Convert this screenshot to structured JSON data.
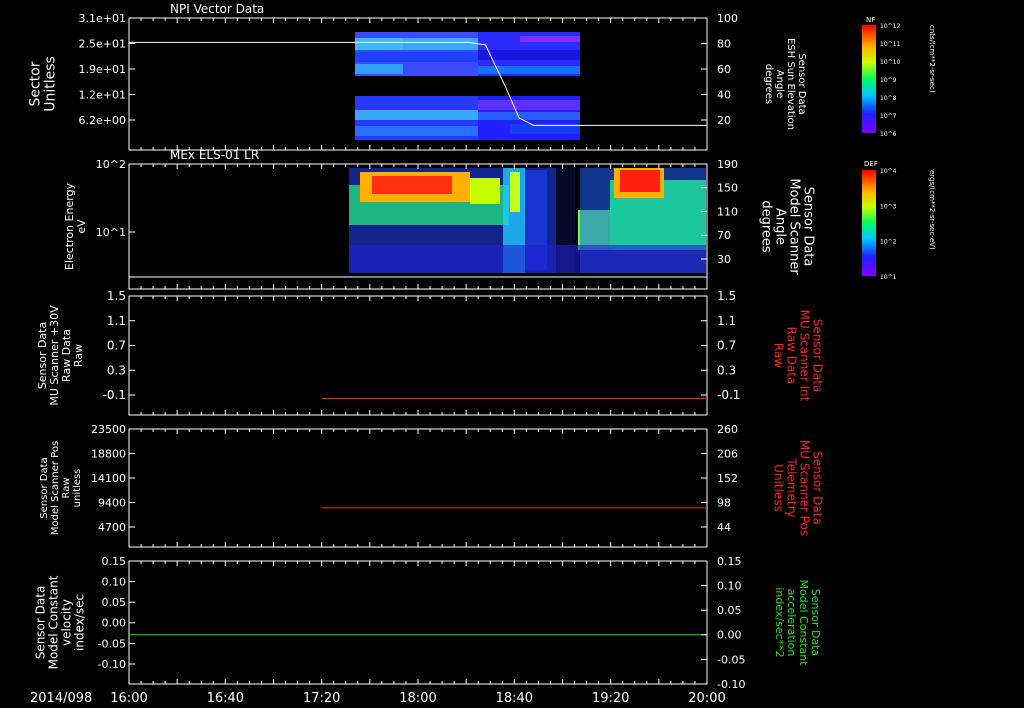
{
  "time_axis": {
    "date_label": "2014/098",
    "tick_labels": [
      "16:00",
      "16:40",
      "17:20",
      "18:00",
      "18:40",
      "19:20",
      "20:00"
    ],
    "range": [
      "16:00",
      "20:00"
    ]
  },
  "colors": {
    "white": "#ffffff",
    "red": "#ff2020",
    "green": "#20e020"
  },
  "chart_data": [
    {
      "type": "heatmap",
      "panel_id": "npi",
      "title": "NPI Vector Data",
      "ylabel": [
        "Sector",
        "Unitless"
      ],
      "yticks": [
        "3.1e+01",
        "2.5e+01",
        "1.9e+01",
        "1.2e+01",
        "6.2e+00"
      ],
      "y2label": [
        "Sensor Data",
        "ESH Sun Elevation",
        "Angle",
        "degrees"
      ],
      "y2ticks": [
        "100",
        "80",
        "60",
        "40",
        "20"
      ],
      "colorbar": {
        "tag": "NF",
        "label": "cnts/(cm**2-sr-sec)",
        "ticks": [
          "10^12",
          "10^11",
          "10^10",
          "10^9",
          "10^8",
          "10^7",
          "10^6"
        ]
      },
      "data_window": [
        "17:24",
        "19:00"
      ],
      "overlay_line": {
        "color": "#ffffff",
        "units": "degrees",
        "points": [
          [
            "16:00",
            80
          ],
          [
            "18:21",
            80
          ],
          [
            "18:28",
            78
          ],
          [
            "18:36",
            45
          ],
          [
            "18:42",
            18
          ],
          [
            "18:48",
            12
          ],
          [
            "20:00",
            12
          ]
        ]
      }
    },
    {
      "type": "heatmap",
      "panel_id": "els",
      "title": "MEx ELS-01 LR",
      "ylabel": [
        "Electron Energy",
        "eV"
      ],
      "yticks": [
        "10^2",
        "10^1"
      ],
      "y2label": [
        "Sensor Data",
        "Model Scanner",
        "Angle",
        "degrees"
      ],
      "y2ticks": [
        "190",
        "150",
        "110",
        "70",
        "30"
      ],
      "colorbar": {
        "tag": "DEF",
        "label": "ergs/(cm**2-sr-sec-eV)",
        "ticks": [
          "10^4",
          "10^3",
          "10^2",
          "10^1"
        ]
      },
      "data_window": [
        "17:24",
        "20:00"
      ],
      "overlay_line": {
        "color": "#ffffff",
        "units": "degrees",
        "points": [
          [
            "16:00",
            10
          ],
          [
            "20:00",
            10
          ]
        ]
      }
    },
    {
      "type": "line",
      "panel_id": "mu_raw",
      "ylabel": [
        "Sensor Data",
        "MU Scanner +30V",
        "Raw Data",
        "Raw"
      ],
      "yticks": [
        "1.5",
        "1.1",
        "0.7",
        "0.3",
        "-0.1"
      ],
      "ylim": [
        -0.3,
        1.5
      ],
      "y2label": [
        "Sensor Data",
        "MU Scanner Int",
        "Raw Data",
        "Raw"
      ],
      "y2ticks": [
        "1.5",
        "1.1",
        "0.7",
        "0.3",
        "-0.1"
      ],
      "series": [
        {
          "color": "#ff2020",
          "x": [
            "17:20",
            "20:00"
          ],
          "y": [
            -0.05,
            -0.05
          ]
        }
      ]
    },
    {
      "type": "line",
      "panel_id": "mu_pos",
      "ylabel": [
        "Sensor Data",
        "Model Scanner Pos",
        "Raw",
        "unitless"
      ],
      "yticks": [
        "23500",
        "18800",
        "14100",
        "9400",
        "4700"
      ],
      "ylim": [
        0,
        23500
      ],
      "y2label": [
        "Sensor Data",
        "MU Scanner Pos",
        "Telemetry",
        "Unitless"
      ],
      "y2ticks": [
        "260",
        "206",
        "152",
        "98",
        "44"
      ],
      "series": [
        {
          "color": "#ff2020",
          "x": [
            "17:20",
            "20:00"
          ],
          "y": [
            7800,
            7800
          ]
        }
      ]
    },
    {
      "type": "line",
      "panel_id": "vel",
      "ylabel": [
        "Sensor Data",
        "Model Constant",
        "velocity",
        "index/sec"
      ],
      "yticks": [
        "0.15",
        "0.10",
        "0.05",
        "0.00",
        "-0.05",
        "-0.10"
      ],
      "ylim": [
        -0.1,
        0.15
      ],
      "y2label": [
        "Sensor Data",
        "Model Constant",
        "acceleration",
        "index/sec**2"
      ],
      "y2ticks": [
        "0.15",
        "0.10",
        "0.05",
        "0.00",
        "-0.05",
        "-0.10"
      ],
      "series": [
        {
          "color": "#20e020",
          "x": [
            "16:00",
            "20:00"
          ],
          "y": [
            0.0,
            0.0
          ]
        }
      ]
    }
  ]
}
